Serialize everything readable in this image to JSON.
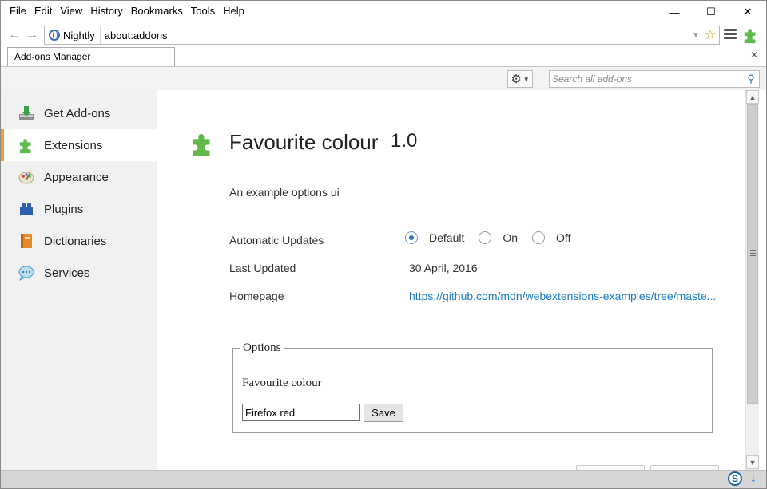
{
  "menu": [
    "File",
    "Edit",
    "View",
    "History",
    "Bookmarks",
    "Tools",
    "Help"
  ],
  "window_controls": {
    "minimize": "—",
    "maximize": "☐",
    "close": "✕"
  },
  "nav": {
    "back_icon": "arrow-left-icon",
    "forward_icon": "arrow-right-icon",
    "identity_label": "Nightly",
    "url": "about:addons"
  },
  "tab": {
    "label": "Add-ons Manager"
  },
  "toolbar": {
    "search_placeholder": "Search all add-ons"
  },
  "sidebar": {
    "items": [
      {
        "label": "Get Add-ons",
        "icon": "download-icon",
        "selected": false
      },
      {
        "label": "Extensions",
        "icon": "puzzle-icon",
        "selected": true
      },
      {
        "label": "Appearance",
        "icon": "palette-icon",
        "selected": false
      },
      {
        "label": "Plugins",
        "icon": "plugin-block-icon",
        "selected": false
      },
      {
        "label": "Dictionaries",
        "icon": "book-icon",
        "selected": false
      },
      {
        "label": "Services",
        "icon": "chat-bubble-icon",
        "selected": false
      }
    ]
  },
  "detail": {
    "name": "Favourite colour",
    "version": "1.0",
    "description": "An example options ui",
    "rows": {
      "updates": {
        "label": "Automatic Updates",
        "options": [
          "Default",
          "On",
          "Off"
        ],
        "selected": "Default"
      },
      "last_updated": {
        "label": "Last Updated",
        "value": "30 April, 2016"
      },
      "homepage": {
        "label": "Homepage",
        "value": "https://github.com/mdn/webextensions-examples/tree/maste..."
      }
    },
    "options": {
      "legend": "Options",
      "field_label": "Favourite colour",
      "field_value": "Firefox red",
      "save_label": "Save"
    }
  },
  "colors": {
    "accent": "#f69d2b",
    "link": "#1b7cc1",
    "puzzle_green": "#5fba4a"
  }
}
